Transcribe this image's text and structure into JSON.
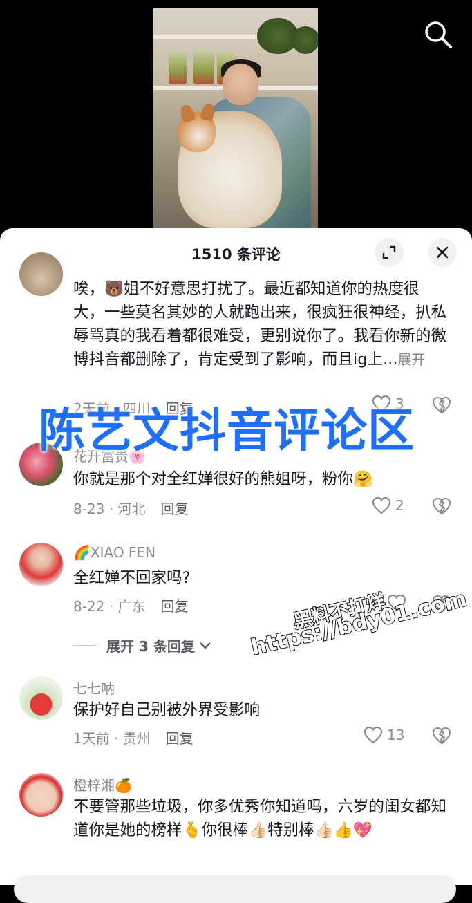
{
  "header": {
    "comment_count": "1510 条评论"
  },
  "icons": {
    "search": "search-icon",
    "expand": "expand-icon",
    "close": "close-icon",
    "heart": "heart-icon",
    "dislike": "broken-heart-icon",
    "chevron": "chevron-down-icon"
  },
  "comments": [
    {
      "text": "唉，🐻姐不好意思打扰了。最近都知道你的热度很大，一些莫名其妙的人就跑出来，很疯狂很神经，扒私辱骂真的我看着都很难受，更别说你了。我看你新的微博抖音都删除了，肯定受到了影响，而且ig上...",
      "expand_label": "展开",
      "meta": "2天前 · 四川",
      "reply": "回复",
      "likes": "3"
    },
    {
      "username": "花开富贵🌸",
      "text": "你就是那个对全红婵很好的熊姐呀，粉你🤗",
      "meta": "8-23 · 河北",
      "reply": "回复",
      "likes": "2"
    },
    {
      "username": "🌈XIAO FEN",
      "text": "全红婵不回家吗?",
      "meta": "8-22 · 广东",
      "reply": "回复",
      "more_replies": "展开 3 条回复"
    },
    {
      "username": "七七呐",
      "text": "保护好自己别被外界受影响",
      "meta": "1天前 · 贵州",
      "reply": "回复",
      "likes": "13"
    },
    {
      "username": "橙梓湘🍊",
      "text": "不要管那些垃圾，你多优秀你知道吗，六岁的闺女都知道你是她的榜样🫰你很棒👍🏻特别棒👍🏻👍💖",
      "meta": "",
      "reply": ""
    }
  ],
  "overlay": {
    "title": "陈艺文抖音评论区",
    "watermark_1": "黑料不打烊",
    "watermark_2": "https://bdy01.com"
  },
  "colors": {
    "title_blue": "#1f6fff",
    "text": "#161823",
    "muted": "#8a8b91"
  }
}
